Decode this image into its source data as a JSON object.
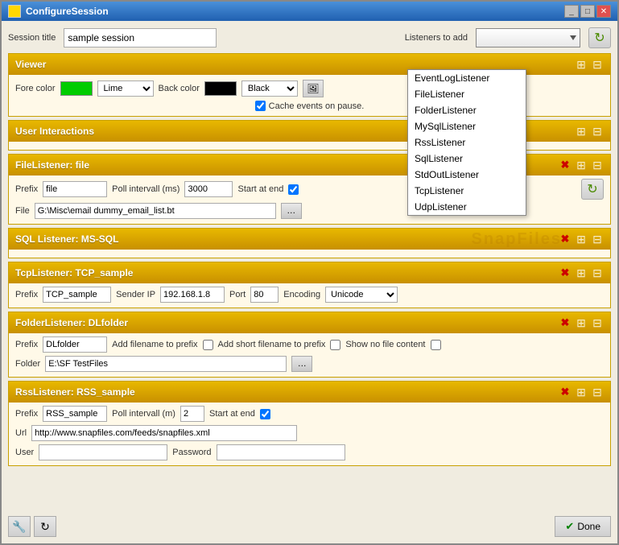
{
  "window": {
    "title": "ConfigureSession"
  },
  "header": {
    "session_label": "Session title",
    "session_value": "sample session",
    "listeners_label": "Listeners to add"
  },
  "dropdown": {
    "items": [
      "EventLogListener",
      "FileListener",
      "FolderListener",
      "MySqlListener",
      "RssListener",
      "SqlListener",
      "StdOutListener",
      "TcpListener",
      "UdpListener"
    ]
  },
  "sections": {
    "viewer": {
      "title": "Viewer",
      "fore_color_label": "Fore color",
      "fore_color_name": "Lime",
      "back_color_label": "Back color",
      "back_color_name": "Black",
      "cache_label": "Cache events on pause."
    },
    "user_interactions": {
      "title": "User Interactions"
    },
    "file_listener": {
      "title": "FileListener: file",
      "prefix_label": "Prefix",
      "prefix_value": "file",
      "poll_label": "Poll intervall (ms)",
      "poll_value": "3000",
      "start_label": "Start at end",
      "file_label": "File",
      "file_value": "G:\\Misc\\email dummy_email_list.bt"
    },
    "sql_listener": {
      "title": "SQL Listener: MS-SQL"
    },
    "tcp_listener": {
      "title": "TcpListener: TCP_sample",
      "prefix_label": "Prefix",
      "prefix_value": "TCP_sample",
      "sender_label": "Sender IP",
      "sender_value": "192.168.1.8",
      "port_label": "Port",
      "port_value": "80",
      "encoding_label": "Encoding",
      "encoding_value": "Unicode"
    },
    "folder_listener": {
      "title": "FolderListener: DLfolder",
      "prefix_label": "Prefix",
      "prefix_value": "DLfolder",
      "add_filename_label": "Add filename to prefix",
      "add_short_label": "Add short filename to prefix",
      "show_no_file_label": "Show no file content",
      "folder_label": "Folder",
      "folder_value": "E:\\SF TestFiles"
    },
    "rss_listener": {
      "title": "RssListener: RSS_sample",
      "prefix_label": "Prefix",
      "prefix_value": "RSS_sample",
      "poll_label": "Poll intervall (m)",
      "poll_value": "2",
      "start_label": "Start at end",
      "url_label": "Url",
      "url_value": "http://www.snapfiles.com/feeds/snapfiles.xml",
      "user_label": "User",
      "user_value": "",
      "password_label": "Password",
      "password_value": ""
    }
  },
  "bottom": {
    "done_label": "Done"
  },
  "icons": {
    "refresh": "↻",
    "expand_collapse": "⊞",
    "red_x": "✖",
    "done_check": "✔",
    "add": "★",
    "remove": "⊟",
    "browse": "…",
    "minimize": "_",
    "maximize": "□",
    "close": "✕"
  }
}
